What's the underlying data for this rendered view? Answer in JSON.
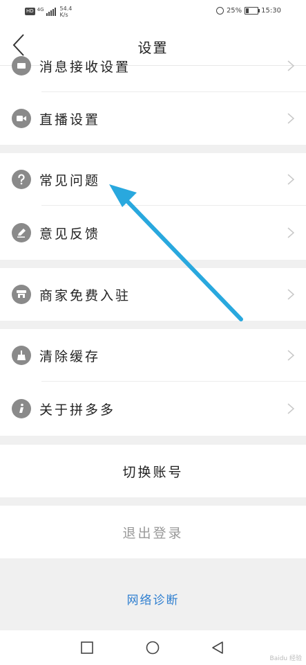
{
  "status": {
    "hd": "HD",
    "net_type": "4G",
    "speed": "54.4",
    "speed_unit": "K/s",
    "battery": "25%",
    "time": "15:30"
  },
  "header": {
    "title": "设置"
  },
  "rows": {
    "message": "消息接收设置",
    "live": "直播设置",
    "faq": "常见问题",
    "feedback": "意见反馈",
    "merchant": "商家免费入驻",
    "clear_cache": "清除缓存",
    "about": "关于拼多多"
  },
  "actions": {
    "switch_account": "切换账号",
    "logout": "退出登录",
    "network_diagnosis": "网络诊断"
  },
  "watermark": "Baidu 经验",
  "icons": {
    "message": "message-icon",
    "live": "video-camera-icon",
    "faq": "question-icon",
    "feedback": "pencil-icon",
    "merchant": "store-icon",
    "clear_cache": "broom-icon",
    "about": "info-icon"
  },
  "colors": {
    "annotation_arrow": "#29a8de",
    "link_blue": "#2f7fd0",
    "icon_gray": "#8a8a8a"
  }
}
